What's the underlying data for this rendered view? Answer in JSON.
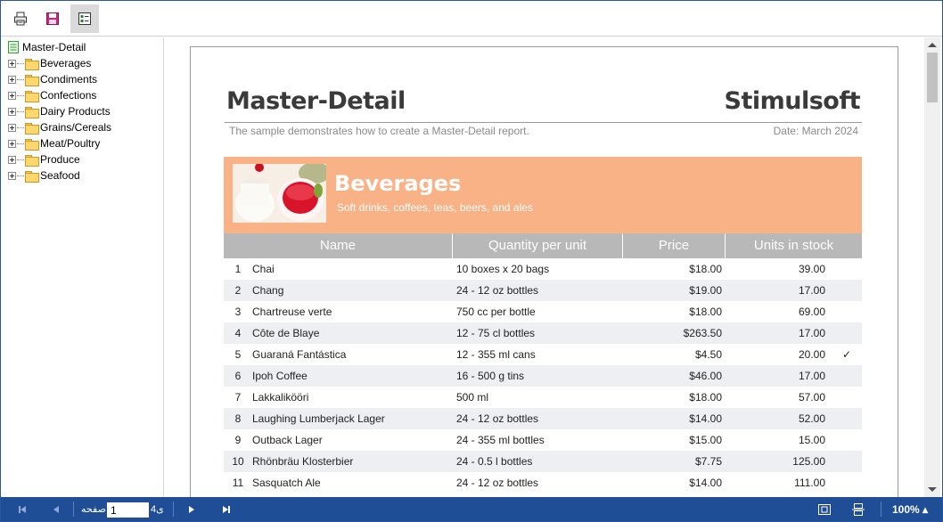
{
  "toolbar": {
    "buttons": [
      {
        "name": "print-icon"
      },
      {
        "name": "save-icon"
      },
      {
        "name": "parameters-icon",
        "active": true
      }
    ]
  },
  "tree": {
    "root": "Master-Detail",
    "items": [
      "Beverages",
      "Condiments",
      "Confections",
      "Dairy Products",
      "Grains/Cereals",
      "Meat/Poultry",
      "Produce",
      "Seafood"
    ]
  },
  "report": {
    "title": "Master-Detail",
    "brand": "Stimulsoft",
    "subtitle": "The sample demonstrates how to create a Master-Detail report.",
    "date": "Date: March 2024",
    "category": {
      "name": "Beverages",
      "description": "Soft drinks, coffees, teas, beers, and ales"
    },
    "columns": [
      "Name",
      "Quantity per unit",
      "Price",
      "Units in stock"
    ],
    "rows": [
      {
        "num": "1",
        "name": "Chai",
        "qty": "10 boxes x 20 bags",
        "price": "$18.00",
        "stock": "39.00",
        "check": ""
      },
      {
        "num": "2",
        "name": "Chang",
        "qty": "24 - 12 oz bottles",
        "price": "$19.00",
        "stock": "17.00",
        "check": ""
      },
      {
        "num": "3",
        "name": "Chartreuse verte",
        "qty": "750 cc per bottle",
        "price": "$18.00",
        "stock": "69.00",
        "check": ""
      },
      {
        "num": "4",
        "name": "Côte de Blaye",
        "qty": "12 - 75 cl bottles",
        "price": "$263.50",
        "stock": "17.00",
        "check": ""
      },
      {
        "num": "5",
        "name": "Guaraná Fantástica",
        "qty": "12 - 355 ml cans",
        "price": "$4.50",
        "stock": "20.00",
        "check": "✓"
      },
      {
        "num": "6",
        "name": "Ipoh Coffee",
        "qty": "16 - 500 g tins",
        "price": "$46.00",
        "stock": "17.00",
        "check": ""
      },
      {
        "num": "7",
        "name": "Lakkalikööri",
        "qty": "500 ml",
        "price": "$18.00",
        "stock": "57.00",
        "check": ""
      },
      {
        "num": "8",
        "name": "Laughing Lumberjack Lager",
        "qty": "24 - 12 oz bottles",
        "price": "$14.00",
        "stock": "52.00",
        "check": ""
      },
      {
        "num": "9",
        "name": "Outback Lager",
        "qty": "24 - 355 ml bottles",
        "price": "$15.00",
        "stock": "15.00",
        "check": ""
      },
      {
        "num": "10",
        "name": "Rhönbräu Klosterbier",
        "qty": "24 - 0.5 l bottles",
        "price": "$7.75",
        "stock": "125.00",
        "check": ""
      },
      {
        "num": "11",
        "name": "Sasquatch Ale",
        "qty": "24 - 12 oz bottles",
        "price": "$14.00",
        "stock": "111.00",
        "check": ""
      }
    ]
  },
  "nav": {
    "page_label": "صفحه",
    "page_value": "1",
    "of_label": "4ی",
    "zoom": "100% ▴"
  },
  "colors": {
    "accent": "#1f4e96",
    "category_band": "#f9b186",
    "header_gray": "#b8b8b8",
    "row_alt": "#eeeff2"
  }
}
